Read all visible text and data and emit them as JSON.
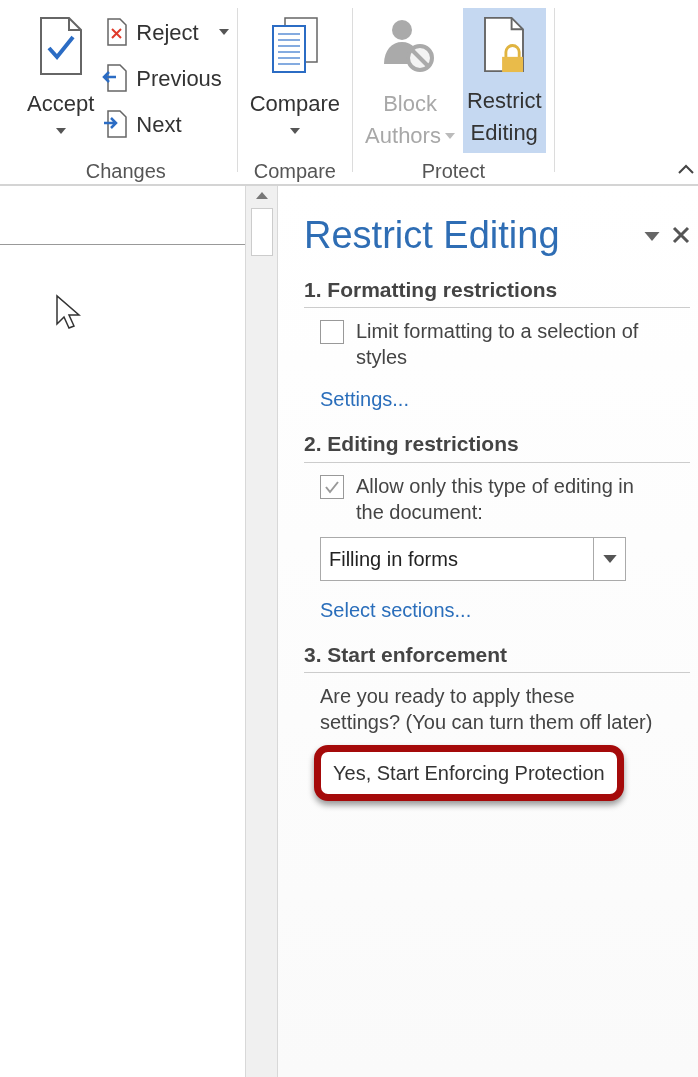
{
  "ribbon": {
    "groups": [
      {
        "label": "Changes",
        "buttons": [
          {
            "label": "Accept",
            "kind": "large",
            "dropdown": true
          },
          {
            "label": "Reject",
            "kind": "small",
            "dropdown": true
          },
          {
            "label": "Previous",
            "kind": "small",
            "dropdown": false
          },
          {
            "label": "Next",
            "kind": "small",
            "dropdown": false
          }
        ]
      },
      {
        "label": "Compare",
        "buttons": [
          {
            "label": "Compare",
            "kind": "large",
            "dropdown": true
          }
        ]
      },
      {
        "label": "Protect",
        "buttons": [
          {
            "label": "Block Authors",
            "kind": "large",
            "dropdown": true,
            "disabled": true,
            "selected": false
          },
          {
            "label": "Restrict Editing",
            "kind": "large",
            "dropdown": false,
            "disabled": false,
            "selected": true
          }
        ]
      }
    ]
  },
  "pane": {
    "title": "Restrict Editing",
    "sections": [
      {
        "heading": "1. Formatting restrictions",
        "checkbox": {
          "label": "Limit formatting to a selection of styles",
          "checked": false
        },
        "link": "Settings..."
      },
      {
        "heading": "2. Editing restrictions",
        "checkbox": {
          "label": "Allow only this type of editing in the document:",
          "checked": true
        },
        "dropdown": {
          "value": "Filling in forms"
        },
        "link": "Select sections..."
      },
      {
        "heading": "3. Start enforcement",
        "text": "Are you ready to apply these settings? (You can turn them off later)",
        "button": {
          "label": "Yes, Start Enforcing Protection",
          "highlighted": true
        }
      }
    ]
  }
}
